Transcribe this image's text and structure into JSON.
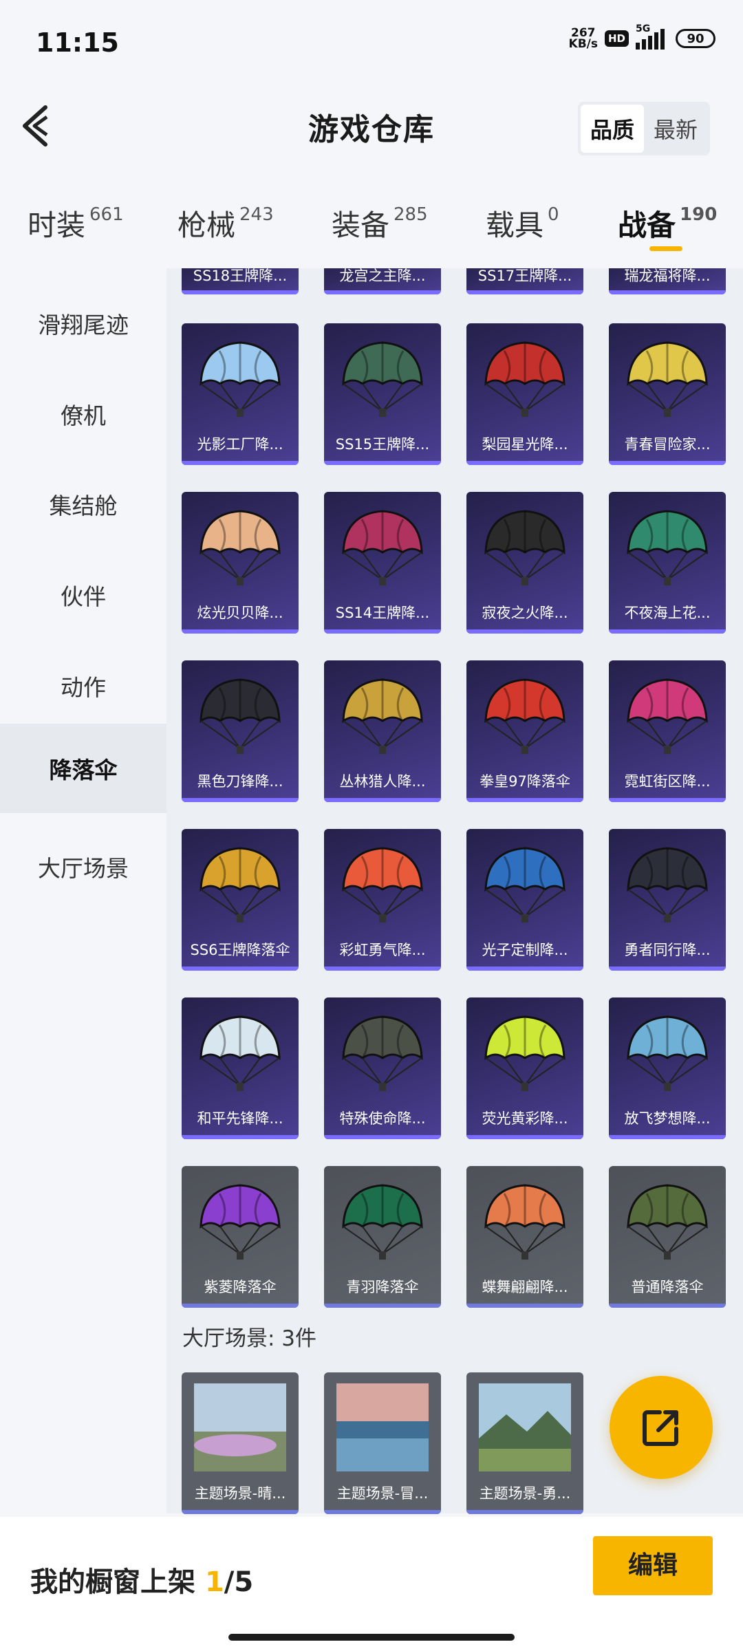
{
  "status": {
    "time": "11:15",
    "speed_top": "267",
    "speed_unit": "KB/s",
    "hd": "HD",
    "network": "5G",
    "battery": "90"
  },
  "header": {
    "title": "游戏仓库",
    "sort": [
      "品质",
      "最新"
    ]
  },
  "tabs": [
    {
      "label": "时装",
      "count": "661"
    },
    {
      "label": "枪械",
      "count": "243"
    },
    {
      "label": "装备",
      "count": "285"
    },
    {
      "label": "载具",
      "count": "0"
    },
    {
      "label": "战备",
      "count": "190"
    }
  ],
  "sidebar": [
    "滑翔尾迹",
    "僚机",
    "集结舱",
    "伙伴",
    "动作",
    "降落伞",
    "大厅场景"
  ],
  "partial_row": [
    "SS18王牌降...",
    "龙宫之主降...",
    "SS17王牌降...",
    "瑞龙福将降..."
  ],
  "items": [
    "光影工厂降...",
    "SS15王牌降...",
    "梨园星光降...",
    "青春冒险家...",
    "炫光贝贝降...",
    "SS14王牌降...",
    "寂夜之火降...",
    "不夜海上花...",
    "黑色刀锋降...",
    "丛林猎人降...",
    "拳皇97降落伞",
    "霓虹街区降...",
    "SS6王牌降落伞",
    "彩虹勇气降...",
    "光子定制降...",
    "勇者同行降...",
    "和平先锋降...",
    "特殊使命降...",
    "荧光黄彩降...",
    "放飞梦想降...",
    "紫菱降落伞",
    "青羽降落伞",
    "蝶舞翩翩降...",
    "普通降落伞"
  ],
  "item_colors": [
    "#9cc9ef",
    "#3f6b55",
    "#c4302b",
    "#e0c74a",
    "#e9b38a",
    "#b0325f",
    "#2a2a2a",
    "#2f8a6e",
    "#2b2b33",
    "#c9a23c",
    "#d4382c",
    "#d13a7a",
    "#d9a22d",
    "#e85a3a",
    "#2f6fbf",
    "#2c2f3a",
    "#d8e6ef",
    "#4c5148",
    "#cde837",
    "#6fb0d6",
    "#8a3fcf",
    "#1d6e4a",
    "#e57a4a",
    "#556b3c"
  ],
  "lobby": {
    "title": "大厅场景: 3件",
    "scenes": [
      "主题场景-晴...",
      "主题场景-冒...",
      "主题场景-勇..."
    ]
  },
  "bottom": {
    "prefix": "我的橱窗上架 ",
    "count": "1",
    "suffix": "/5",
    "edit": "编辑"
  }
}
